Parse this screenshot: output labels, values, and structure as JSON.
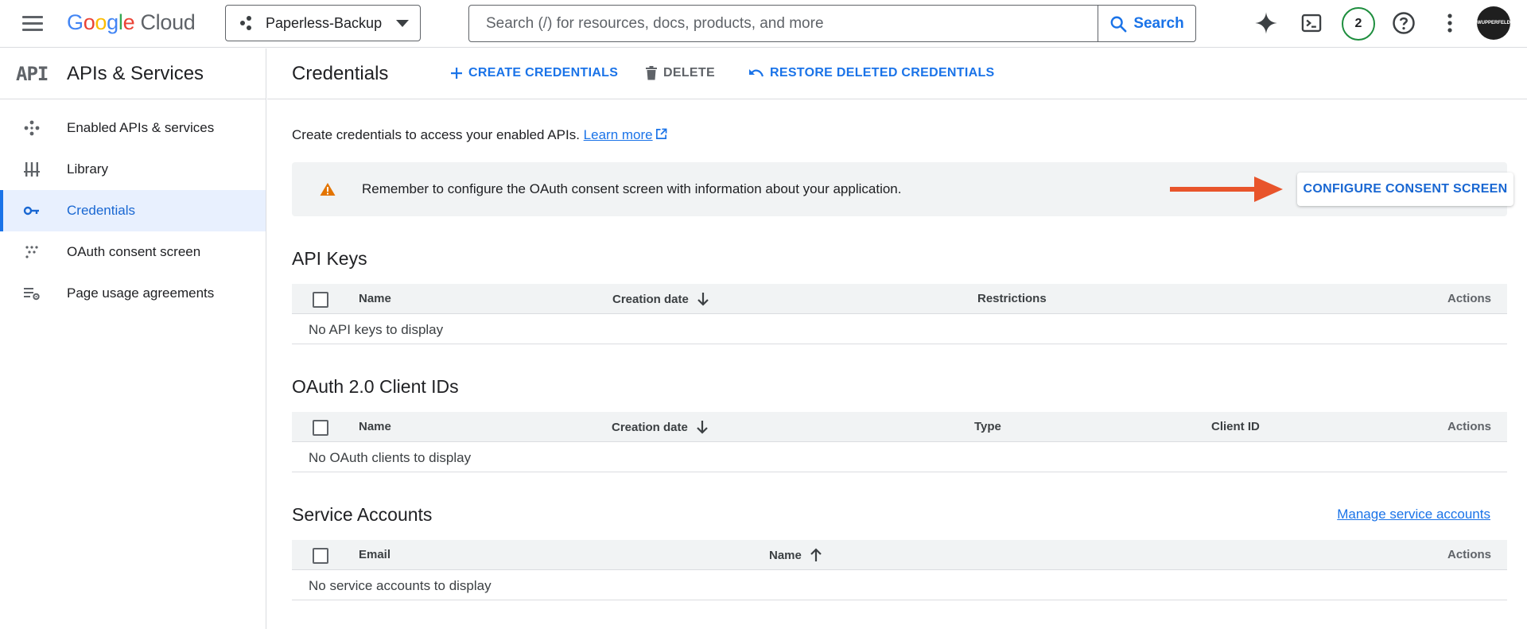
{
  "topbar": {
    "logo_google": "Google",
    "logo_cloud": " Cloud",
    "project_name": "Paperless-Backup",
    "search_placeholder": "Search (/) for resources, docs, products, and more",
    "search_button": "Search",
    "notifications_count": "2",
    "avatar_text": "WUPPERFELD"
  },
  "sidebar": {
    "logo": "API",
    "title": "APIs & Services",
    "items": [
      {
        "label": "Enabled APIs & services",
        "icon": "diamond-dots-icon",
        "active": false
      },
      {
        "label": "Library",
        "icon": "library-icon",
        "active": false
      },
      {
        "label": "Credentials",
        "icon": "key-icon",
        "active": true
      },
      {
        "label": "OAuth consent screen",
        "icon": "consent-dots-icon",
        "active": false
      },
      {
        "label": "Page usage agreements",
        "icon": "settings-list-icon",
        "active": false
      }
    ]
  },
  "main": {
    "title": "Credentials",
    "actions": {
      "create": "CREATE CREDENTIALS",
      "delete": "DELETE",
      "restore": "RESTORE DELETED CREDENTIALS"
    },
    "intro_text": "Create credentials to access your enabled APIs.",
    "learn_more": "Learn more",
    "banner": {
      "message": "Remember to configure the OAuth consent screen with information about your application.",
      "button": "CONFIGURE CONSENT SCREEN"
    },
    "api_keys": {
      "title": "API Keys",
      "columns": [
        "Name",
        "Creation date",
        "Restrictions",
        "Actions"
      ],
      "empty": "No API keys to display"
    },
    "oauth": {
      "title": "OAuth 2.0 Client IDs",
      "columns": [
        "Name",
        "Creation date",
        "Type",
        "Client ID",
        "Actions"
      ],
      "empty": "No OAuth clients to display"
    },
    "service_accounts": {
      "title": "Service Accounts",
      "manage_link": "Manage service accounts",
      "columns": [
        "Email",
        "Name",
        "Actions"
      ],
      "empty": "No service accounts to display"
    }
  },
  "colors": {
    "accent": "#1a73e8",
    "warning": "#e37400",
    "annotation_arrow": "#e8542b",
    "badge_ring": "#1e8e3e"
  }
}
